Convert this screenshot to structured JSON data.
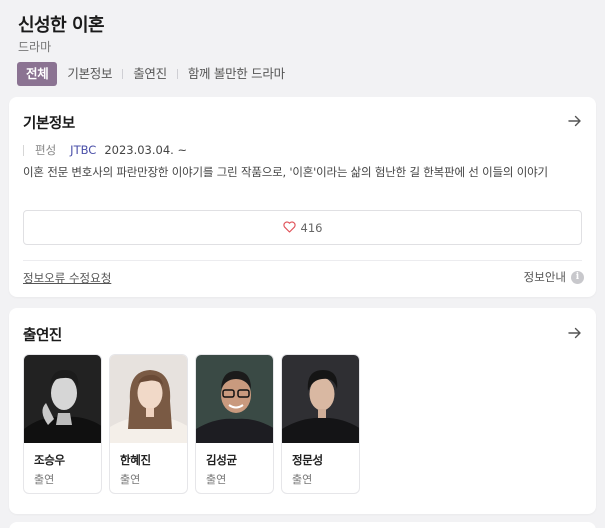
{
  "header": {
    "title": "신성한 이혼",
    "genre": "드라마",
    "tabs": [
      "전체",
      "기본정보",
      "출연진",
      "함께 볼만한 드라마"
    ]
  },
  "basic_info": {
    "heading": "기본정보",
    "meta_label": "편성",
    "channel": "JTBC",
    "air_date": "2023.03.04. ~",
    "description": "이혼 전문 변호사의 파란만장한 이야기를 그린 작품으로, '이혼'이라는 삶의 험난한 길 한복판에 선 이들의 이야기",
    "like_count": "416",
    "report_link": "정보오류 수정요청",
    "info_guide": "정보안내",
    "info_icon_glyph": "i"
  },
  "cast": {
    "heading": "출연진",
    "members": [
      {
        "name": "조승우",
        "role": "출연"
      },
      {
        "name": "한혜진",
        "role": "출연"
      },
      {
        "name": "김성균",
        "role": "출연"
      },
      {
        "name": "정문성",
        "role": "출연"
      }
    ]
  },
  "colors": {
    "accent": "#8b7392",
    "link": "#4a4fa8",
    "heart": "#e0555c",
    "background": "#f2f2f4"
  },
  "icons": {
    "more": "arrow-right-icon",
    "like": "heart-icon",
    "info": "info-icon"
  }
}
